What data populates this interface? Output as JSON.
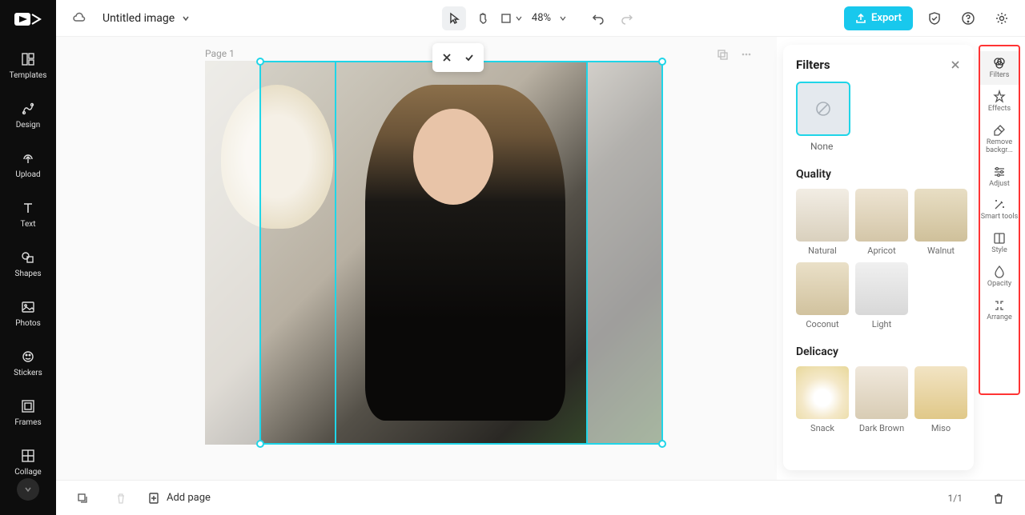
{
  "header": {
    "doc_title": "Untitled image",
    "zoom": "48%",
    "export_label": "Export"
  },
  "left_nav": {
    "items": [
      {
        "label": "Templates"
      },
      {
        "label": "Design"
      },
      {
        "label": "Upload"
      },
      {
        "label": "Text"
      },
      {
        "label": "Shapes"
      },
      {
        "label": "Photos"
      },
      {
        "label": "Stickers"
      },
      {
        "label": "Frames"
      },
      {
        "label": "Collage"
      }
    ]
  },
  "canvas": {
    "page_label": "Page 1"
  },
  "filters_panel": {
    "title": "Filters",
    "none_label": "None",
    "sections": [
      {
        "title": "Quality",
        "items": [
          "Natural",
          "Apricot",
          "Walnut",
          "Coconut",
          "Light"
        ]
      },
      {
        "title": "Delicacy",
        "items": [
          "Snack",
          "Dark Brown",
          "Miso"
        ]
      }
    ]
  },
  "right_tools": {
    "items": [
      {
        "label": "Filters"
      },
      {
        "label": "Effects"
      },
      {
        "label": "Remove backgr..."
      },
      {
        "label": "Adjust"
      },
      {
        "label": "Smart tools"
      },
      {
        "label": "Style"
      },
      {
        "label": "Opacity"
      },
      {
        "label": "Arrange"
      }
    ]
  },
  "bottom": {
    "add_page": "Add page",
    "page_count": "1/1"
  }
}
